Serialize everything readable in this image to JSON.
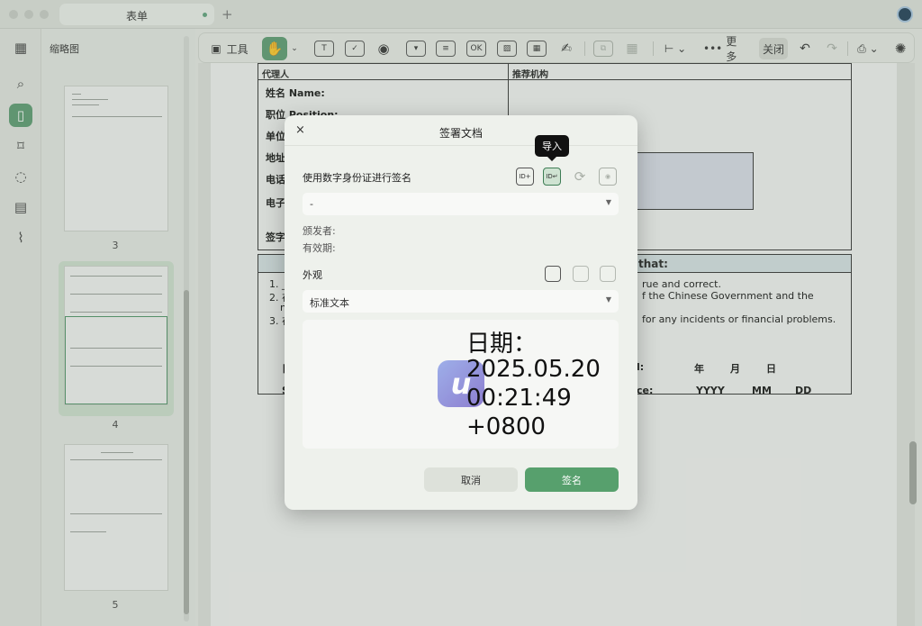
{
  "window": {
    "tab_title": "表单",
    "new_tab": "+"
  },
  "sidebar": {
    "panel_title": "缩略图",
    "rail_icons": [
      "grid-icon",
      "search-icon",
      "page-icon",
      "bookmark-icon",
      "comment-icon",
      "attachment-page-icon",
      "paperclip-icon"
    ],
    "thumbnails": [
      {
        "page": "3"
      },
      {
        "page": "4"
      },
      {
        "page": "5"
      }
    ]
  },
  "toolbar": {
    "tools_label": "工具",
    "more_label": "更多",
    "close_label": "关闭"
  },
  "document": {
    "col_agent": "代理人",
    "col_agency": "推荐机构",
    "field_name": "姓名 Name:",
    "field_position": "职位 Position:",
    "field_unit": "单位",
    "field_address": "地址",
    "field_phone": "电话",
    "field_email": "电子",
    "field_sign": "签字",
    "section_that": "that:",
    "line1": "rue and correct.",
    "line2": "f the Chinese Government and the",
    "line3": "for any incidents or financial problems.",
    "date_zh_year": "年",
    "date_zh_month": "月",
    "date_zh_day": "日",
    "date_en_y": "YYYY",
    "date_en_m": "MM",
    "date_en_d": "DD",
    "list_1": "1. _",
    "list_2": "2. 在",
    "list_2b": "n",
    "list_3": "3. 在",
    "mark_e": "日",
    "mark_s": "S",
    "mark_colon": "l:",
    "mark_ce": "ce:"
  },
  "dialog": {
    "title": "签署文档",
    "close": "×",
    "tooltip": "导入",
    "section_digital_id": "使用数字身份证进行签名",
    "id_select_value": "-",
    "issuer_label": "颁发者:",
    "validity_label": "有效期:",
    "section_appearance": "外观",
    "appearance_value": "标准文本",
    "preview_lines": [
      "日期：",
      "2025.05.20",
      "00:21:49",
      "+0800"
    ],
    "logo_glyph": "u",
    "cancel": "取消",
    "sign": "签名"
  },
  "colors": {
    "accent": "#57a06d",
    "background": "#e8ebe6"
  }
}
